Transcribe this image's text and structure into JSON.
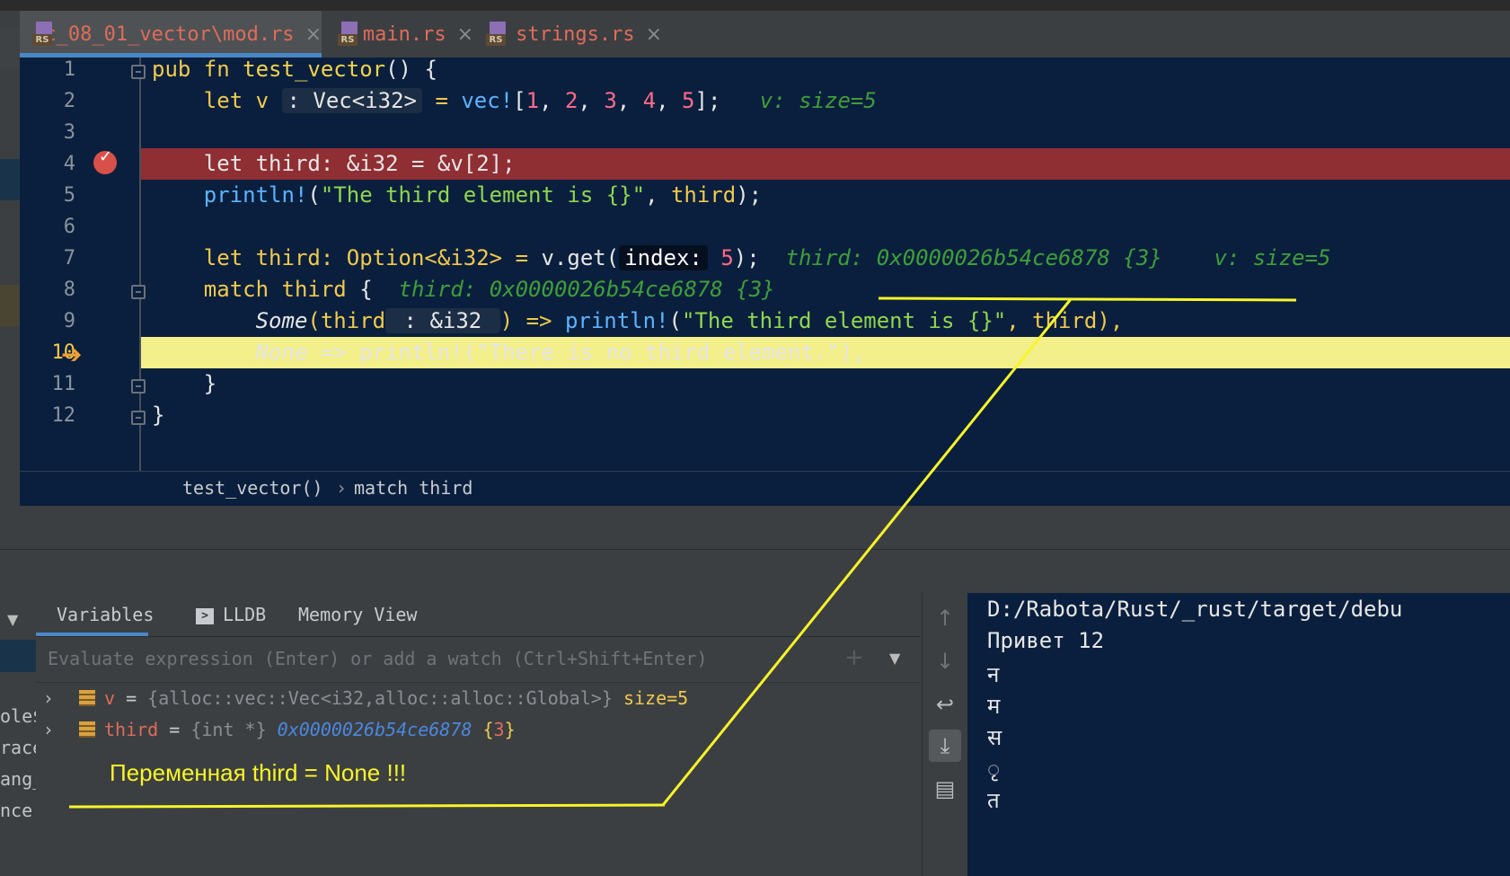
{
  "tabs": [
    {
      "label": "c_08_01_vector\\mod.rs",
      "icon": "rust-file-icon",
      "active": true
    },
    {
      "label": "main.rs",
      "icon": "rust-file-icon",
      "active": false
    },
    {
      "label": "strings.rs",
      "icon": "rust-file-icon",
      "active": false
    }
  ],
  "rs_icon_label": "RS",
  "close_glyph": "×",
  "editor": {
    "line_numbers": [
      "1",
      "2",
      "3",
      "4",
      "5",
      "6",
      "7",
      "8",
      "9",
      "10",
      "11",
      "12"
    ],
    "l1": {
      "a": "pub fn ",
      "b": "test_vector",
      "c": "() {"
    },
    "l2": {
      "a": "    let v ",
      "hint": ": Vec<i32>",
      "b": " = ",
      "mac": "vec!",
      "c": "[",
      "n1": "1",
      "n2": "2",
      "n3": "3",
      "n4": "4",
      "n5": "5",
      "d": "];",
      "inline": "v: size=5"
    },
    "l4": {
      "text": "    let third: &i32 = &v[2];"
    },
    "l5": {
      "mac": "    println!",
      "a": "(",
      "str": "\"The third element is {}\"",
      "b": ", ",
      "c": "third",
      "d": ");"
    },
    "l7": {
      "a": "    let third: Option<&i32> = ",
      "b": "v.get(",
      "hint": "index:",
      "n": " 5",
      "c": ");",
      "inline1": "third: 0x0000026b54ce6878 {3}",
      "inline2": "v: size=5"
    },
    "l8": {
      "a": "    match ",
      "b": "third",
      "c": " {",
      "inline": "third: 0x0000026b54ce6878 {3}"
    },
    "l9": {
      "a": "        Some",
      "b": "(third",
      "hint": " : &i32 ",
      "c": ") => ",
      "mac": "println!",
      "d": "(",
      "str": "\"The third element is {}\"",
      "e": ", third),"
    },
    "l10": {
      "a": "        None",
      "b": " => println!(\"There is no third element.\"),"
    },
    "l11": {
      "text": "    }"
    },
    "l12": {
      "text": "}"
    }
  },
  "breadcrumb": {
    "fn": "test_vector()",
    "sep": "›",
    "scope": "match third"
  },
  "debugger": {
    "tabs": {
      "variables": "Variables",
      "lldb": "LLDB",
      "memory": "Memory View"
    },
    "lldb_icon_glyph": ">",
    "eval_placeholder": "Evaluate expression (Enter) or add a watch (Ctrl+Shift+Enter)",
    "variables": [
      {
        "name": "v",
        "eq": " = ",
        "type": "{alloc::vec::Vec<i32,alloc::alloc::Global>}",
        "value": " size=5"
      },
      {
        "name": "third",
        "eq": " = ",
        "type": "{int *}",
        "addr": " 0x0000026b54ce6878",
        "brace_open": " {",
        "num": "3",
        "brace_close": "}"
      }
    ],
    "left_fragments": [
      "ole$",
      "race",
      "ang_",
      "nce"
    ]
  },
  "annotation": "Переменная third = None !!!",
  "console": {
    "lines": [
      "D:/Rabota/Rust/_rust/target/debu",
      "Привет 12",
      "न",
      "म",
      "स",
      "ृ",
      "त"
    ]
  },
  "colors": {
    "accent_tab": "#4a88c7",
    "breakpoint_row": "#8f2e33",
    "exec_row": "#f3ef8a",
    "annotation": "#f7f52a"
  }
}
